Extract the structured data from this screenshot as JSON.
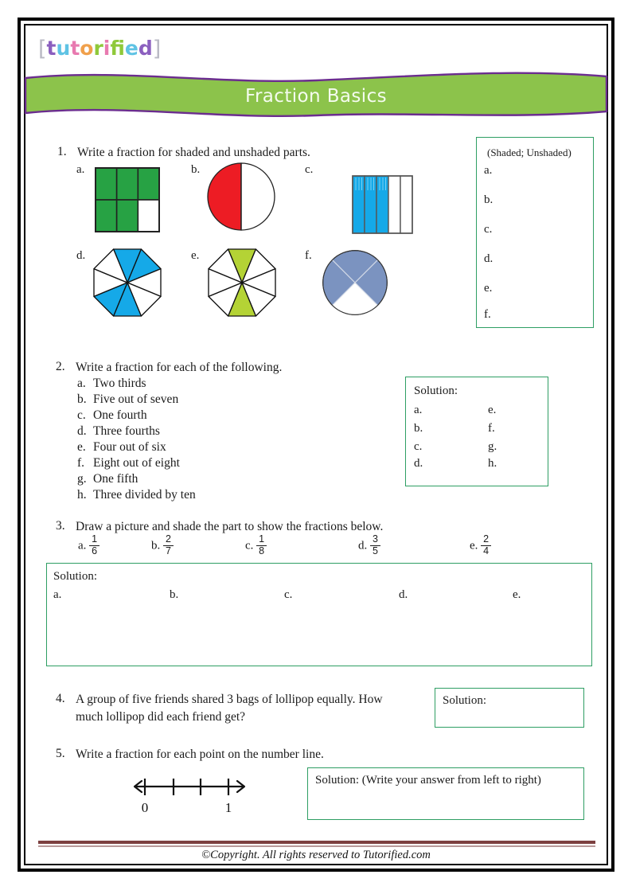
{
  "brand": {
    "name": "tutorified",
    "letters": [
      {
        "ch": "t",
        "color": "#8b5fbf"
      },
      {
        "ch": "u",
        "color": "#5fc3e4"
      },
      {
        "ch": "t",
        "color": "#e87ab0"
      },
      {
        "ch": "o",
        "color": "#f0a04b"
      },
      {
        "ch": "r",
        "color": "#8fc93a"
      },
      {
        "ch": "i",
        "color": "#e87ab0"
      },
      {
        "ch": "f",
        "color": "#8fc93a"
      },
      {
        "ch": "i",
        "color": "#f0a04b"
      },
      {
        "ch": "e",
        "color": "#5fc3e4"
      },
      {
        "ch": "d",
        "color": "#8b5fbf"
      }
    ]
  },
  "header": {
    "title": "Fraction Basics",
    "banner_color": "#8cc34b",
    "banner_edge_color": "#6b2d8f",
    "title_color": "#f4fbee"
  },
  "colors": {
    "answer_box_border": "#2e9e63",
    "green_fill": "#27a244",
    "red_fill": "#ed1c24",
    "blue_fill": "#15a9e8",
    "lime_fill": "#b4d335",
    "slate_fill": "#7b93c0",
    "footer_rule": "#7d4040"
  },
  "questions": [
    {
      "number": "1.",
      "prompt": "Write a fraction for shaded and unshaded parts.",
      "items": [
        {
          "label": "a.",
          "shape": "grid-3x2",
          "total": 6,
          "shaded": 5,
          "color": "#27a244"
        },
        {
          "label": "b.",
          "shape": "circle-halves",
          "total": 2,
          "shaded": 1,
          "color": "#ed1c24"
        },
        {
          "label": "c.",
          "shape": "bar-5",
          "total": 5,
          "shaded": 3,
          "color": "#15a9e8"
        },
        {
          "label": "d.",
          "shape": "octagon-8",
          "total": 8,
          "shaded": 4,
          "color": "#15a9e8"
        },
        {
          "label": "e.",
          "shape": "octagon-8",
          "total": 8,
          "shaded": 2,
          "color": "#b4d335"
        },
        {
          "label": "f.",
          "shape": "circle-quarters",
          "total": 4,
          "shaded": 3,
          "color": "#7b93c0"
        }
      ],
      "answer_box": {
        "heading": "(Shaded; Unshaded)",
        "rows": [
          "a.",
          "b.",
          "c.",
          "d.",
          "e.",
          "f."
        ]
      }
    },
    {
      "number": "2.",
      "prompt": "Write a fraction for each of the following.",
      "items": [
        {
          "label": "a.",
          "text": "Two thirds"
        },
        {
          "label": "b.",
          "text": "Five out of seven"
        },
        {
          "label": "c.",
          "text": "One fourth"
        },
        {
          "label": "d.",
          "text": "Three fourths"
        },
        {
          "label": "e.",
          "text": "Four out of six"
        },
        {
          "label": "f.",
          "text": "Eight out of eight"
        },
        {
          "label": "g.",
          "text": "One fifth"
        },
        {
          "label": "h.",
          "text": "Three divided by ten"
        }
      ],
      "answer_box": {
        "heading": "Solution:",
        "col1": [
          "a.",
          "b.",
          "c.",
          "d."
        ],
        "col2": [
          "e.",
          "f.",
          "g.",
          "h."
        ]
      }
    },
    {
      "number": "3.",
      "prompt": "Draw a picture and shade the part to show the fractions below.",
      "items": [
        {
          "label": "a.",
          "num": "1",
          "den": "6"
        },
        {
          "label": "b.",
          "num": "2",
          "den": "7"
        },
        {
          "label": "c.",
          "num": "1",
          "den": "8"
        },
        {
          "label": "d.",
          "num": "3",
          "den": "5"
        },
        {
          "label": "e.",
          "num": "2",
          "den": "4"
        }
      ],
      "answer_box": {
        "heading": "Solution:",
        "rows": [
          "a.",
          "b.",
          "c.",
          "d.",
          "e."
        ]
      }
    },
    {
      "number": "4.",
      "prompt_line1": "A group of five friends shared 3 bags of lollipop equally. How",
      "prompt_line2": "much lollipop did each friend get?",
      "answer_box": {
        "heading": "Solution:"
      }
    },
    {
      "number": "5.",
      "prompt": "Write a fraction for each point on the number line.",
      "number_line": {
        "ticks": 4,
        "labels": [
          {
            "text": "0",
            "tick_index": 0
          },
          {
            "text": "1",
            "tick_index": 3
          }
        ]
      },
      "answer_box": {
        "heading": "Solution: (Write your answer from left to right)"
      }
    }
  ],
  "footer": {
    "copyright": "©Copyright. All rights reserved to Tutorified.com"
  }
}
